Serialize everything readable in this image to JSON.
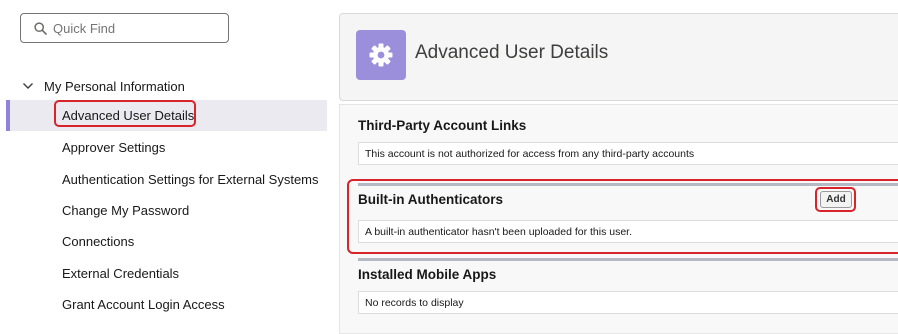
{
  "search": {
    "placeholder": "Quick Find"
  },
  "sidebar": {
    "group_label": "My Personal Information",
    "items": [
      {
        "label": "Advanced User Details",
        "selected": true
      },
      {
        "label": "Approver Settings"
      },
      {
        "label": "Authentication Settings for External Systems"
      },
      {
        "label": "Change My Password"
      },
      {
        "label": "Connections"
      },
      {
        "label": "External Credentials"
      },
      {
        "label": "Grant Account Login Access"
      }
    ]
  },
  "header": {
    "title": "Advanced User Details",
    "icon": "gear-icon",
    "icon_bg": "#9b8fdc"
  },
  "sections": {
    "third_party": {
      "title": "Third-Party Account Links",
      "message": "This account is not authorized for access from any third-party accounts"
    },
    "authenticators": {
      "title": "Built-in Authenticators",
      "add_label": "Add",
      "message": "A built-in authenticator hasn't been uploaded for this user."
    },
    "mobile_apps": {
      "title": "Installed Mobile Apps",
      "message": "No records to display"
    }
  },
  "colors": {
    "highlight": "#d8232a",
    "accent": "#8e83d8"
  }
}
